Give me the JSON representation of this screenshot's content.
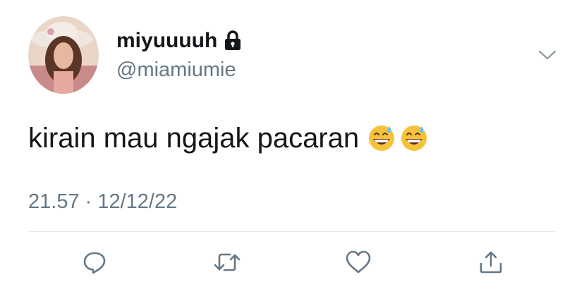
{
  "tweet": {
    "display_name": "miyuuuuh",
    "handle": "@miamiumie",
    "text": "kirain mau ngajak pacaran",
    "emojis": [
      "grinning-face-with-sweat",
      "grinning-face-with-sweat"
    ],
    "timestamp": "21.57 · 12/12/22",
    "protected": true
  },
  "icons": {
    "lock": "lock-icon",
    "menu": "chevron-down-icon",
    "reply": "reply-icon",
    "retweet": "retweet-icon",
    "like": "heart-icon",
    "share": "share-icon"
  },
  "colors": {
    "text_primary": "#14171a",
    "text_secondary": "#657786",
    "icon": "#657786",
    "divider": "#e1e8ed"
  }
}
